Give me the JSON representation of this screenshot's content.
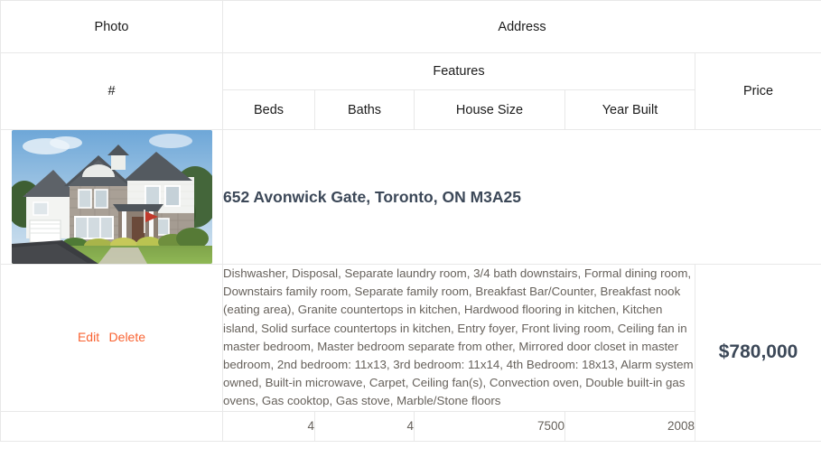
{
  "table": {
    "headers": {
      "photo": "Photo",
      "address": "Address",
      "number": "#",
      "features": "Features",
      "price": "Price",
      "beds": "Beds",
      "baths": "Baths",
      "house_size": "House Size",
      "year_built": "Year Built"
    },
    "row": {
      "photo_alt": "house-photo",
      "address": "652 Avonwick Gate, Toronto, ON M3A25",
      "actions": {
        "edit": "Edit",
        "delete": "Delete"
      },
      "features_text": "Dishwasher, Disposal, Separate laundry room, 3/4 bath downstairs, Formal dining room, Downstairs family room, Separate family room, Breakfast Bar/Counter, Breakfast nook (eating area), Granite countertops in kitchen, Hardwood flooring in kitchen, Kitchen island, Solid surface countertops in kitchen, Entry foyer, Front living room, Ceiling fan in master bedroom, Master bedroom separate from other, Mirrored door closet in master bedroom, 2nd bedroom: 11x13, 3rd bedroom: 11x14, 4th Bedroom: 18x13, Alarm system owned, Built-in microwave, Carpet, Ceiling fan(s), Convection oven, Double built-in gas ovens, Gas cooktop, Gas stove, Marble/Stone floors",
      "price": "$780,000",
      "beds": "4",
      "baths": "4",
      "house_size": "7500",
      "year_built": "2008"
    }
  },
  "colors": {
    "accent": "#f96332",
    "text_dark": "#3c4858",
    "text_body": "#66615b",
    "border": "#e8e8e8"
  }
}
